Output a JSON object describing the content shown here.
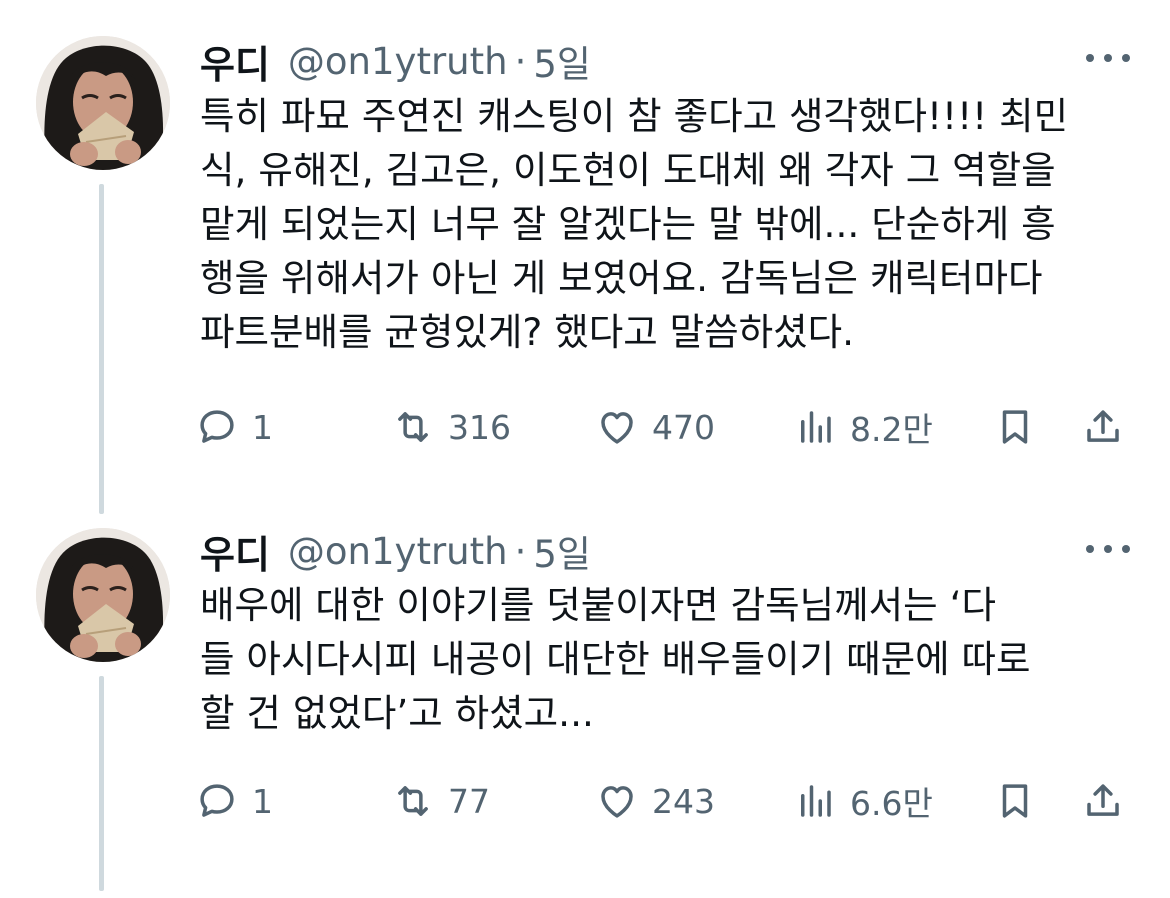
{
  "tweets": [
    {
      "author": {
        "display_name": "우디",
        "handle": "@on1ytruth",
        "avatar_icon": "avatar-photo"
      },
      "separator": "·",
      "time": "5일",
      "more_icon": "more-dots-icon",
      "text_lines": [
        "특히 파묘 주연진 캐스팅이 참 좋다고 생각했다!!!! 최민",
        "식, 유해진, 김고은, 이도현이 도대체 왜 각자 그 역할을",
        "맡게 되었는지 너무 잘 알겠다는 말 밖에... 단순하게 흥",
        "행을 위해서가 아닌 게 보였어요. 감독님은 캐릭터마다",
        "파트분배를 균형있게? 했다고 말씀하셨다."
      ],
      "stats": {
        "replies": "1",
        "retweets": "316",
        "likes": "470",
        "views": "8.2만"
      }
    },
    {
      "author": {
        "display_name": "우디",
        "handle": "@on1ytruth",
        "avatar_icon": "avatar-photo"
      },
      "separator": "·",
      "time": "5일",
      "more_icon": "more-dots-icon",
      "text_lines": [
        "배우에 대한 이야기를 덧붙이자면 감독님께서는 ‘다",
        "들 아시다시피 내공이 대단한 배우들이기 때문에 따로",
        "할 건 없었다’고 하셨고..."
      ],
      "stats": {
        "replies": "1",
        "retweets": "77",
        "likes": "243",
        "views": "6.6만"
      }
    }
  ],
  "icons": {
    "reply": "reply-bubble-icon",
    "retweet": "retweet-icon",
    "like": "heart-icon",
    "views": "views-bar-chart-icon",
    "bookmark": "bookmark-icon",
    "share": "share-upload-icon"
  },
  "colors": {
    "primary_text": "#0f1419",
    "secondary_text": "#536471",
    "thread_line": "#cfd9de",
    "background": "#ffffff"
  }
}
